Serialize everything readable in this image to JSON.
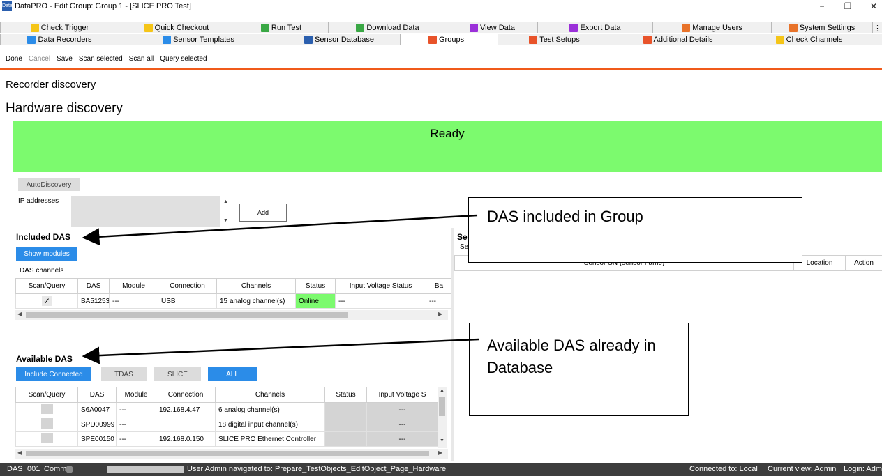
{
  "window": {
    "title": "DataPRO - Edit Group: Group 1  - [SLICE PRO Test]",
    "app_icon_text": "Data PRO",
    "minimize": "−",
    "restore": "❐",
    "close": "✕"
  },
  "tabs_row1": [
    {
      "label": "Check Trigger",
      "icon": "check-trigger-icon",
      "color": "#f5c518"
    },
    {
      "label": "Quick Checkout",
      "icon": "quick-checkout-icon",
      "color": "#f5c518"
    },
    {
      "label": "Run Test",
      "icon": "run-test-icon",
      "color": "#3aa845"
    },
    {
      "label": "Download Data",
      "icon": "download-data-icon",
      "color": "#3aa845"
    },
    {
      "label": "View Data",
      "icon": "view-data-icon",
      "color": "#9b30d9"
    },
    {
      "label": "Export Data",
      "icon": "export-data-icon",
      "color": "#9b30d9"
    },
    {
      "label": "Manage Users",
      "icon": "manage-users-icon",
      "color": "#e8732a"
    },
    {
      "label": "System Settings",
      "icon": "system-settings-icon",
      "color": "#e8732a"
    }
  ],
  "tabs_row1_overflow": "⋮",
  "tabs_row2": [
    {
      "label": "Data Recorders",
      "icon": "data-recorders-icon",
      "color": "#2b8ce8"
    },
    {
      "label": "Sensor Templates",
      "icon": "sensor-templates-icon",
      "color": "#2b8ce8"
    },
    {
      "label": "Sensor Database",
      "icon": "sensor-database-icon",
      "color": "#2b5fae"
    },
    {
      "label": "Groups",
      "icon": "groups-icon",
      "color": "#e8532a",
      "active": true
    },
    {
      "label": "Test Setups",
      "icon": "test-setups-icon",
      "color": "#e8532a"
    },
    {
      "label": "Additional Details",
      "icon": "additional-details-icon",
      "color": "#e8532a"
    },
    {
      "label": "Check Channels",
      "icon": "check-channels-icon",
      "color": "#f5c518"
    }
  ],
  "toolbar": {
    "done": "Done",
    "cancel": "Cancel",
    "save": "Save",
    "scan_selected": "Scan selected",
    "scan_all": "Scan all",
    "query_selected": "Query selected"
  },
  "headings": {
    "recorder_discovery": "Recorder discovery",
    "hardware_discovery": "Hardware discovery"
  },
  "status_banner": {
    "text": "Ready",
    "color": "#7cfa6e"
  },
  "autodiscovery": {
    "button": "AutoDiscovery",
    "ip_label": "IP addresses",
    "ip_value": "",
    "add_button": "Add"
  },
  "included": {
    "title": "Included DAS",
    "show_modules": "Show modules",
    "channels_label": "DAS channels",
    "columns": [
      "Scan/Query",
      "DAS",
      "Module",
      "Connection",
      "Channels",
      "Status",
      "Input Voltage Status",
      "Ba"
    ],
    "rows": [
      {
        "checked": "✓",
        "das": "BA51253",
        "module": "---",
        "connection": "USB",
        "channels": "15 analog channel(s)",
        "status": "Online",
        "input_voltage": "---",
        "ba": "---"
      }
    ]
  },
  "available": {
    "title": "Available DAS",
    "filters": [
      "Include Connected",
      "TDAS",
      "SLICE",
      "ALL"
    ],
    "columns": [
      "Scan/Query",
      "DAS",
      "Module",
      "Connection",
      "Channels",
      "Status",
      "Input Voltage S"
    ],
    "rows": [
      {
        "das": "S6A0047",
        "module": "---",
        "connection": "192.168.4.47",
        "channels": "6 analog channel(s)",
        "status": "",
        "input_voltage": "---"
      },
      {
        "das": "SPD00999",
        "module": "---",
        "connection": "",
        "channels": "18 digital input channel(s)",
        "status": "",
        "input_voltage": "---"
      },
      {
        "das": "SPE00150",
        "module": "---",
        "connection": "192.168.0.150",
        "channels": "SLICE PRO Ethernet Controller",
        "status": "",
        "input_voltage": "---"
      }
    ]
  },
  "sensors_panel": {
    "title_partial": "Se",
    "subtitle_partial": "Se",
    "columns": [
      "Sensor SN (sensor name)",
      "Location",
      "Action"
    ]
  },
  "callouts": {
    "included": "DAS included in Group",
    "available": "Available DAS already in Database"
  },
  "statusbar": {
    "das": "DAS",
    "das_num": "001",
    "comm": "Comm",
    "message": "User Admin navigated to: Prepare_TestObjects_EditObject_Page_Hardware",
    "connected": "Connected to:  Local",
    "view": "Current view: Admin",
    "login": "Login: Adm"
  }
}
